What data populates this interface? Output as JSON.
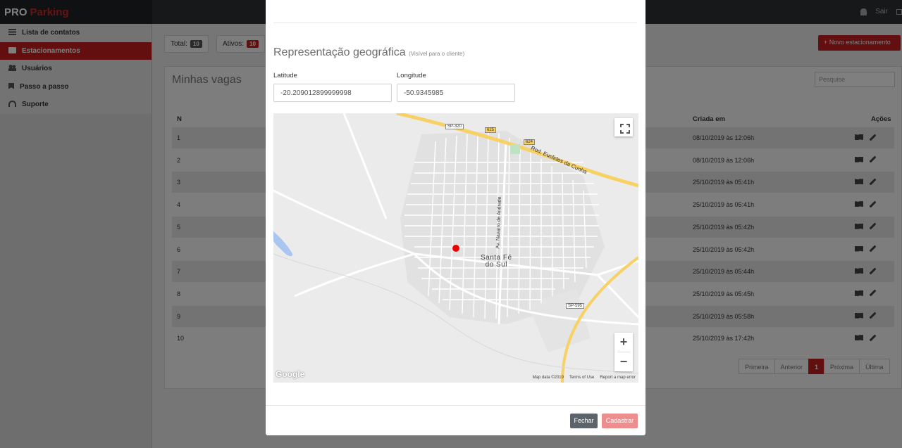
{
  "brand": {
    "pro": "PRO",
    "parking": "Parking"
  },
  "topbar": {
    "logout": "Sair"
  },
  "sidebar": {
    "items": [
      {
        "label": "Lista de contatos",
        "icon": "list-icon"
      },
      {
        "label": "Estacionamentos",
        "icon": "document-icon",
        "active": true
      },
      {
        "label": "Usuários",
        "icon": "users-icon"
      },
      {
        "label": "Passo a passo",
        "icon": "bookmark-icon"
      },
      {
        "label": "Suporte",
        "icon": "headset-icon"
      }
    ]
  },
  "stats": {
    "total_label": "Total:",
    "total_value": "10",
    "ativos_label": "Ativos:",
    "ativos_value": "10"
  },
  "new_button": "+ Novo estacionamento",
  "panel": {
    "title": "Minhas vagas",
    "search_placeholder": "Pesquise",
    "columns": {
      "n": "N",
      "created": "Criada em",
      "actions": "Ações"
    },
    "rows": [
      {
        "n": "1",
        "created": "08/10/2019 às 12:06h"
      },
      {
        "n": "2",
        "created": "08/10/2019 às 12:06h"
      },
      {
        "n": "3",
        "created": "25/10/2019 às 05:41h"
      },
      {
        "n": "4",
        "created": "25/10/2019 às 05:41h"
      },
      {
        "n": "5",
        "created": "25/10/2019 às 05:42h"
      },
      {
        "n": "6",
        "created": "25/10/2019 às 05:42h"
      },
      {
        "n": "7",
        "created": "25/10/2019 às 05:44h"
      },
      {
        "n": "8",
        "created": "25/10/2019 às 05:45h"
      },
      {
        "n": "9",
        "created": "25/10/2019 às 05:58h"
      },
      {
        "n": "10",
        "created": "25/10/2019 às 17:42h"
      }
    ],
    "pagination": {
      "first": "Primeira",
      "prev": "Anterior",
      "current": "1",
      "next": "Próxima",
      "last": "Última"
    }
  },
  "modal": {
    "title": "Representação geográfica",
    "subtitle": "(Visível para o cliente)",
    "latitude_label": "Latitude",
    "latitude_value": "-20.209012899999998",
    "longitude_label": "Longitude",
    "longitude_value": "-50.9345985",
    "map": {
      "city": [
        "Santa Fé",
        "do Sul"
      ],
      "shields": [
        "SP-320",
        "625",
        "624",
        "SP-595"
      ],
      "road_names": [
        "Rod. Euclides da Cunha",
        "Av. Navarro de Andrade"
      ],
      "attribution": [
        "Map data ©2019",
        "Terms of Use",
        "Report a map error"
      ],
      "logo": "Google",
      "zoom_in": "+",
      "zoom_out": "−"
    },
    "close_button": "Fechar",
    "save_button": "Cadastrar"
  },
  "colors": {
    "accent": "#c81f1f",
    "topbar": "#2c3034",
    "marker": "#ee0000"
  }
}
